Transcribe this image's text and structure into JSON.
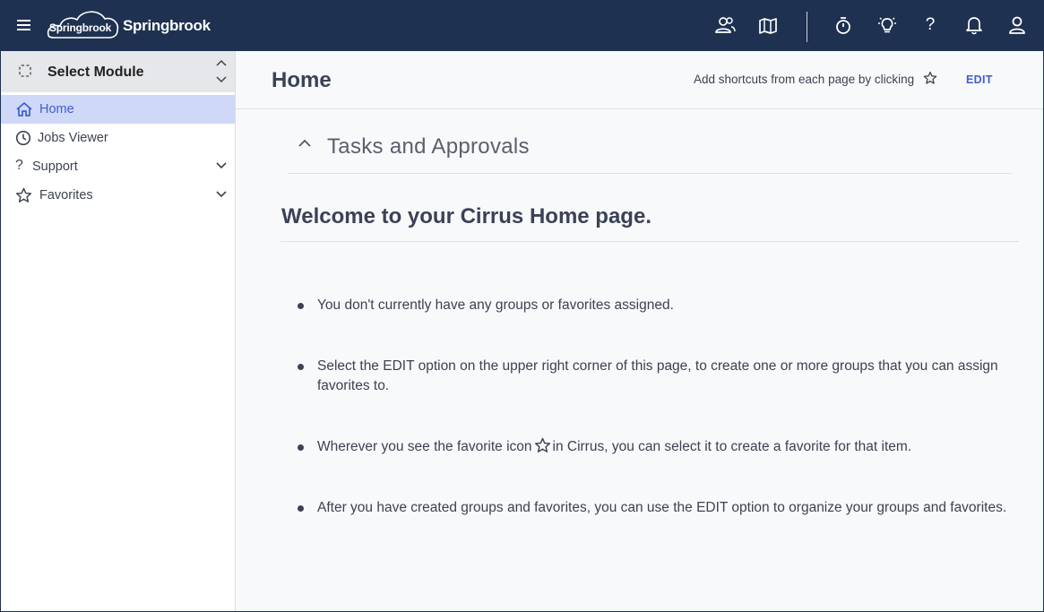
{
  "app": {
    "logo_small": "Springbrook",
    "logo_big": "Springbrook"
  },
  "topbar": {
    "icons": [
      "users-icon",
      "map-icon",
      "stopwatch-icon",
      "lightbulb-icon",
      "help-icon",
      "bell-icon",
      "user-icon"
    ],
    "help_label": "?"
  },
  "sidebar": {
    "module_label": "Select Module",
    "items": [
      {
        "label": "Home",
        "icon": "home-icon",
        "active": true
      },
      {
        "label": "Jobs Viewer",
        "icon": "clock-icon"
      },
      {
        "label": "Support",
        "icon": "question-icon",
        "expandable": true
      },
      {
        "label": "Favorites",
        "icon": "star-icon",
        "expandable": true
      }
    ],
    "support_glyph": "?"
  },
  "main": {
    "title": "Home",
    "shortcut_hint": "Add shortcuts from each page by clicking",
    "edit_label": "EDIT",
    "tasks_title": "Tasks and Approvals",
    "welcome": "Welcome to your Cirrus Home page.",
    "bullets": [
      "You don't currently have any groups or favorites assigned.",
      "Select the EDIT option on the upper right corner of this page, to create one or more groups that you can assign favorites to.",
      {
        "before": "Wherever you see the favorite icon",
        "after": "in Cirrus, you can select it to create a favorite for that item."
      },
      "After you have created groups and favorites, you can use the EDIT option to organize your groups and favorites."
    ]
  },
  "colors": {
    "topbar": "#1e3150",
    "accent": "#3f5ed2",
    "active_bg": "#cfd8f7"
  }
}
